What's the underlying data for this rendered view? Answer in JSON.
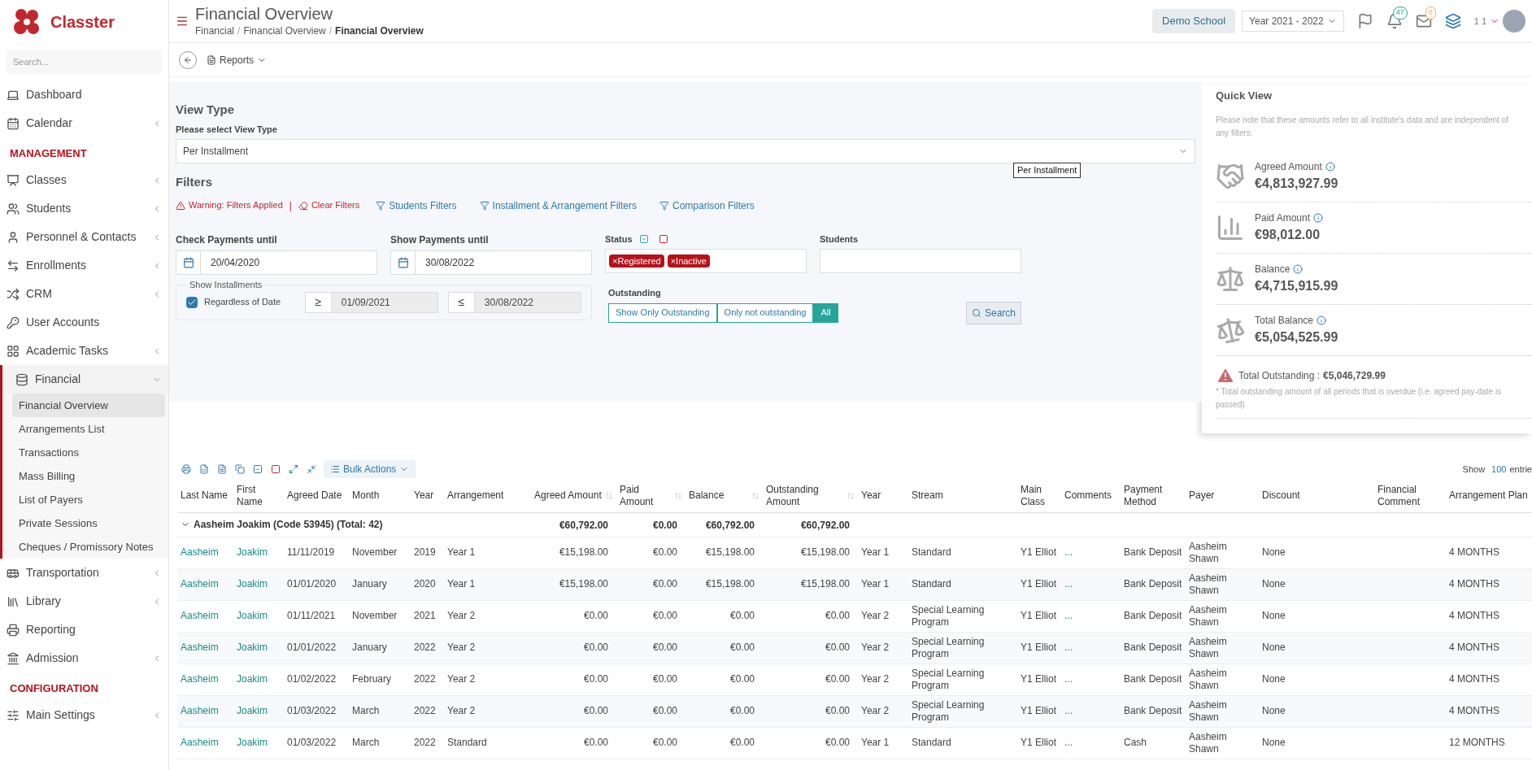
{
  "sidebar": {
    "logo_text": "Classter",
    "search_placeholder": "Search...",
    "items": [
      {
        "kind": "item",
        "label": "Dashboard",
        "has_submenu": false
      },
      {
        "kind": "item",
        "label": "Calendar",
        "has_submenu": true
      },
      {
        "kind": "section",
        "label": "MANAGEMENT"
      },
      {
        "kind": "item",
        "label": "Classes",
        "has_submenu": true
      },
      {
        "kind": "item",
        "label": "Students",
        "has_submenu": true
      },
      {
        "kind": "item",
        "label": "Personnel & Contacts",
        "has_submenu": true
      },
      {
        "kind": "item",
        "label": "Enrollments",
        "has_submenu": true
      },
      {
        "kind": "item",
        "label": "CRM",
        "has_submenu": true
      },
      {
        "kind": "item",
        "label": "User Accounts",
        "has_submenu": false
      },
      {
        "kind": "item",
        "label": "Academic Tasks",
        "has_submenu": true
      },
      {
        "kind": "item",
        "label": "Financial",
        "has_submenu": true,
        "expanded": true,
        "children": [
          {
            "label": "Financial Overview",
            "selected": true
          },
          {
            "label": "Arrangements List",
            "selected": false
          },
          {
            "label": "Transactions",
            "selected": false
          },
          {
            "label": "Mass Billing",
            "selected": false
          },
          {
            "label": "List of Payers",
            "selected": false
          },
          {
            "label": "Private Sessions",
            "selected": false
          },
          {
            "label": "Cheques / Promissory Notes",
            "selected": false
          }
        ]
      },
      {
        "kind": "item",
        "label": "Transportation",
        "has_submenu": true
      },
      {
        "kind": "item",
        "label": "Library",
        "has_submenu": true
      },
      {
        "kind": "item",
        "label": "Reporting",
        "has_submenu": false
      },
      {
        "kind": "item",
        "label": "Admission",
        "has_submenu": true
      },
      {
        "kind": "section",
        "label": "CONFIGURATION"
      },
      {
        "kind": "item",
        "label": "Main Settings",
        "has_submenu": true
      }
    ]
  },
  "header": {
    "title": "Financial Overview",
    "breadcrumbs": [
      {
        "label": "Financial",
        "current": false
      },
      {
        "label": "Financial Overview",
        "current": false
      },
      {
        "label": "Financial Overview",
        "current": true
      }
    ],
    "separator": "/",
    "school": "Demo School",
    "year": "Year 2021 - 2022",
    "notifications": "47",
    "messages": "8",
    "user": "1 1"
  },
  "toolbar": {
    "reports": "Reports"
  },
  "view_type": {
    "heading": "View Type",
    "label": "Please select View Type",
    "value": "Per Installment",
    "tooltip": "Per Installment"
  },
  "filters": {
    "heading": "Filters",
    "warning": "Warning: Filters Applied",
    "divider": "|",
    "clear": "Clear Filters",
    "links": [
      "Students Filters",
      "Installment & Arrangement Filters",
      "Comparison Filters"
    ],
    "check_payments": {
      "label": "Check Payments until",
      "value": "20/04/2020"
    },
    "show_payments": {
      "label": "Show Payments until",
      "value": "30/08/2022"
    },
    "status": {
      "label": "Status",
      "remove_symbol": "×",
      "tags": [
        "Registered",
        "Inactive"
      ]
    },
    "students": {
      "label": "Students"
    },
    "installments": {
      "legend": "Show Installments",
      "regardless": {
        "label": "Regardless of Date",
        "checked": true
      },
      "from": {
        "sign": "≥",
        "value": "01/09/2021",
        "disabled": true
      },
      "to": {
        "sign": "≤",
        "value": "30/08/2022",
        "disabled": true
      }
    },
    "outstanding": {
      "label": "Outstanding",
      "options": [
        {
          "label": "Show Only Outstanding",
          "selected": false
        },
        {
          "label": "Only not outstanding",
          "selected": false
        },
        {
          "label": "All",
          "selected": true
        }
      ]
    },
    "search": "Search"
  },
  "quick_view": {
    "title": "Quick View",
    "note": "Please note that these amounts refer to all institute's data and are independent of any filters.",
    "items": [
      {
        "kind": "handshake",
        "label": "Agreed Amount",
        "value": "€4,813,927.99"
      },
      {
        "kind": "chart",
        "label": "Paid Amount",
        "value": "€98,012.00"
      },
      {
        "kind": "scale",
        "label": "Balance",
        "value": "€4,715,915.99"
      },
      {
        "kind": "tilted-scale",
        "label": "Total Balance",
        "value": "€5,054,525.99"
      }
    ],
    "outstanding_label": "Total Outstanding :",
    "outstanding_value": "€5,046,729.99",
    "outstanding_note": "* Total outstanding amount of all periods that is overdue (i.e. agreed pay-date is passed)"
  },
  "table": {
    "bulk_actions": "Bulk Actions",
    "show_label": "Show",
    "show_count": "100",
    "show_suffix": "entrie",
    "columns": [
      {
        "label": "Last Name",
        "kind": "link",
        "sortable": false
      },
      {
        "label": "First Name",
        "kind": "link",
        "sortable": false
      },
      {
        "label": "Agreed Date",
        "kind": "text",
        "sortable": false
      },
      {
        "label": "Month",
        "kind": "text",
        "sortable": false
      },
      {
        "label": "Year",
        "kind": "text",
        "sortable": false
      },
      {
        "label": "Arrangement",
        "kind": "text",
        "sortable": false
      },
      {
        "label": "Agreed Amount",
        "kind": "money",
        "sortable": true
      },
      {
        "label": "Paid Amount",
        "kind": "money",
        "sortable": true
      },
      {
        "label": "Balance",
        "kind": "money",
        "sortable": true
      },
      {
        "label": "Outstanding Amount",
        "kind": "money",
        "sortable": true
      },
      {
        "label": "Year",
        "kind": "text",
        "sortable": false
      },
      {
        "label": "Stream",
        "kind": "text",
        "sortable": false
      },
      {
        "label": "Main Class",
        "kind": "text",
        "sortable": false
      },
      {
        "label": "Comments",
        "kind": "link",
        "sortable": false
      },
      {
        "label": "Payment Method",
        "kind": "text",
        "sortable": false
      },
      {
        "label": "Payer",
        "kind": "text",
        "sortable": false
      },
      {
        "label": "Discount",
        "kind": "text",
        "sortable": false
      },
      {
        "label": "Financial Comment",
        "kind": "text",
        "sortable": false
      },
      {
        "label": "Arrangement Plan",
        "kind": "text",
        "sortable": false
      }
    ],
    "group": {
      "label": "Aasheim Joakim (Code 53945) (Total: 42)",
      "expanded": true,
      "totals": [
        "€60,792.00",
        "€0.00",
        "€60,792.00",
        "€60,792.00"
      ]
    },
    "rows": [
      [
        "Aasheim",
        "Joakim",
        "11/11/2019",
        "November",
        "2019",
        "Year 1",
        "€15,198.00",
        "€0.00",
        "€15,198.00",
        "€15,198.00",
        "Year 1",
        "Standard",
        "Y1 Elliot",
        "...",
        "Bank Deposit",
        "Aasheim Shawn",
        "None",
        "",
        "4 MONTHS"
      ],
      [
        "Aasheim",
        "Joakim",
        "01/01/2020",
        "January",
        "2020",
        "Year 1",
        "€15,198.00",
        "€0.00",
        "€15,198.00",
        "€15,198.00",
        "Year 1",
        "Standard",
        "Y1 Elliot",
        "...",
        "Bank Deposit",
        "Aasheim Shawn",
        "None",
        "",
        "4 MONTHS"
      ],
      [
        "Aasheim",
        "Joakim",
        "01/11/2021",
        "November",
        "2021",
        "Year 2",
        "€0.00",
        "€0.00",
        "€0.00",
        "€0.00",
        "Year 2",
        "Special Learning Program",
        "Y1 Elliot",
        "...",
        "Bank Deposit",
        "Aasheim Shawn",
        "None",
        "",
        "4 MONTHS"
      ],
      [
        "Aasheim",
        "Joakim",
        "01/01/2022",
        "January",
        "2022",
        "Year 2",
        "€0.00",
        "€0.00",
        "€0.00",
        "€0.00",
        "Year 2",
        "Special Learning Program",
        "Y1 Elliot",
        "...",
        "Bank Deposit",
        "Aasheim Shawn",
        "None",
        "",
        "4 MONTHS"
      ],
      [
        "Aasheim",
        "Joakim",
        "01/02/2022",
        "February",
        "2022",
        "Year 2",
        "€0.00",
        "€0.00",
        "€0.00",
        "€0.00",
        "Year 2",
        "Special Learning Program",
        "Y1 Elliot",
        "...",
        "Bank Deposit",
        "Aasheim Shawn",
        "None",
        "",
        "4 MONTHS"
      ],
      [
        "Aasheim",
        "Joakim",
        "01/03/2022",
        "March",
        "2022",
        "Year 2",
        "€0.00",
        "€0.00",
        "€0.00",
        "€0.00",
        "Year 2",
        "Special Learning Program",
        "Y1 Elliot",
        "...",
        "Bank Deposit",
        "Aasheim Shawn",
        "None",
        "",
        "4 MONTHS"
      ],
      [
        "Aasheim",
        "Joakim",
        "01/03/2022",
        "March",
        "2022",
        "Standard",
        "€0.00",
        "€0.00",
        "€0.00",
        "€0.00",
        "Year 1",
        "Standard",
        "Y1 Elliot",
        "...",
        "Cash",
        "Aasheim Shawn",
        "None",
        "",
        "12 MONTHS"
      ]
    ]
  }
}
